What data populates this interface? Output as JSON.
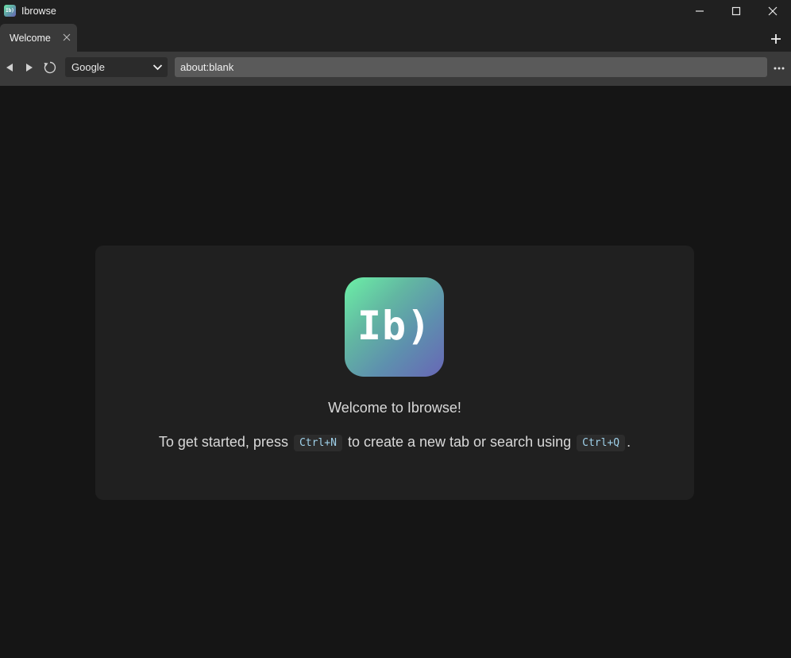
{
  "window": {
    "title": "Ibrowse",
    "icon_text": "Ib)",
    "controls": [
      "minimize",
      "maximize",
      "close"
    ]
  },
  "tabs": [
    {
      "label": "Welcome",
      "active": true
    }
  ],
  "navbar": {
    "search_engine": "Google",
    "address": "about:blank"
  },
  "welcome": {
    "logo_text": "Ib)",
    "heading": "Welcome to Ibrowse!",
    "line_before": "To get started, press",
    "shortcut_new_tab": "Ctrl+N",
    "line_middle": "to create a new tab or search using",
    "shortcut_search": "Ctrl+Q",
    "line_end": "."
  },
  "colors": {
    "background": "#151515",
    "card": "#202020",
    "toolbar": "#3a3a3a",
    "address_bar": "#5a5a5a",
    "shortcut_text": "#9fd1ea",
    "logo_gradient_start": "#6cf0a6",
    "logo_gradient_end": "#6866b6"
  }
}
